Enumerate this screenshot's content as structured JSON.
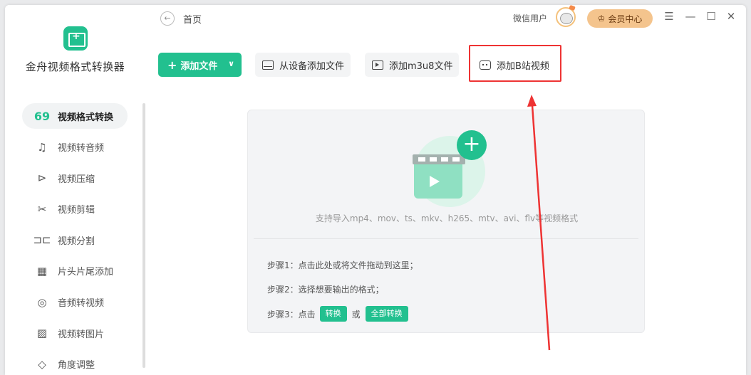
{
  "app": {
    "name": "金舟视频格式转换器",
    "logo_glyph": "+"
  },
  "sidebar": {
    "items": [
      {
        "label": "视频格式转换",
        "icon": "video-format-icon",
        "glyph": "69",
        "active": true
      },
      {
        "label": "视频转音频",
        "icon": "music-note-icon",
        "glyph": "♫"
      },
      {
        "label": "视频压缩",
        "icon": "compress-icon",
        "glyph": "⊳"
      },
      {
        "label": "视频剪辑",
        "icon": "scissors-icon",
        "glyph": "✂"
      },
      {
        "label": "视频分割",
        "icon": "split-icon",
        "glyph": "⊐⊏"
      },
      {
        "label": "片头片尾添加",
        "icon": "film-strip-icon",
        "glyph": "▦"
      },
      {
        "label": "音频转视频",
        "icon": "audio-icon",
        "glyph": "◎"
      },
      {
        "label": "视频转图片",
        "icon": "image-icon",
        "glyph": "▨"
      },
      {
        "label": "角度调整",
        "icon": "rotate-icon",
        "glyph": "◇"
      }
    ]
  },
  "header": {
    "back_glyph": "←",
    "breadcrumb": "首页",
    "user_name": "微信用户",
    "vip_label": "会员中心",
    "vip_glyph": "♔",
    "menu_glyph": "☰",
    "minimize_glyph": "—",
    "maximize_glyph": "☐",
    "close_glyph": "✕"
  },
  "toolbar": {
    "add_file": "添加文件",
    "add_plus": "+",
    "add_caret": "∨",
    "from_device": "从设备添加文件",
    "add_m3u8": "添加m3u8文件",
    "add_bilibili": "添加B站视频"
  },
  "drop": {
    "plus_glyph": "+",
    "hint": "支持导入mp4、mov、ts、mkv、h265、mtv、avi、flv等视频格式",
    "step1": "步骤1：点击此处或将文件拖动到这里；",
    "step2": "步骤2：选择想要输出的格式；",
    "step3_prefix": "步骤3：点击",
    "step3_convert": "转换",
    "step3_or": "或",
    "step3_convert_all": "全部转换"
  },
  "colors": {
    "accent": "#22c08f",
    "highlight": "#e33333",
    "vip": "#f4c48d"
  }
}
